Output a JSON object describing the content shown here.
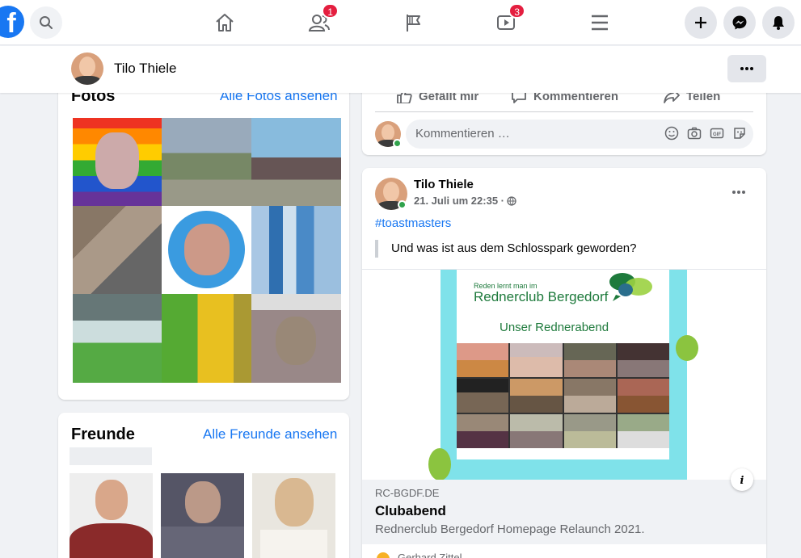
{
  "nav": {
    "logo_letter": "f",
    "friends_badge": "1",
    "watch_badge": "3"
  },
  "profile_bar": {
    "name": "Tilo Thiele"
  },
  "photos_card": {
    "title": "Fotos",
    "link": "Alle Fotos ansehen"
  },
  "friends_card": {
    "title": "Freunde",
    "link": "Alle Freunde ansehen"
  },
  "top_post": {
    "actions": [
      "Gefällt mir",
      "Kommentieren",
      "Teilen"
    ],
    "comment_placeholder": "Kommentieren …"
  },
  "post": {
    "author": "Tilo Thiele",
    "date": "21. Juli um 22:35 ·",
    "hashtag": "#toastmasters",
    "quote": "Und was ist aus dem Schlosspark geworden?",
    "image": {
      "line1": "Reden lernt man im",
      "line2": "Rednerclub Bergedorf",
      "line3": "Unser Rednerabend"
    },
    "link": {
      "domain": "RC-BGDF.DE",
      "title": "Clubabend",
      "description": "Rednerclub Bergedorf Homepage Relaunch 2021."
    },
    "next_comment_author": "Gerhard Zittel"
  },
  "colors": {
    "brand": "#1877f2",
    "badge": "#e41e3f",
    "online": "#31a24c",
    "image_frame": "#7fe2ea",
    "rednerclub_green": "#1e7a3c"
  }
}
